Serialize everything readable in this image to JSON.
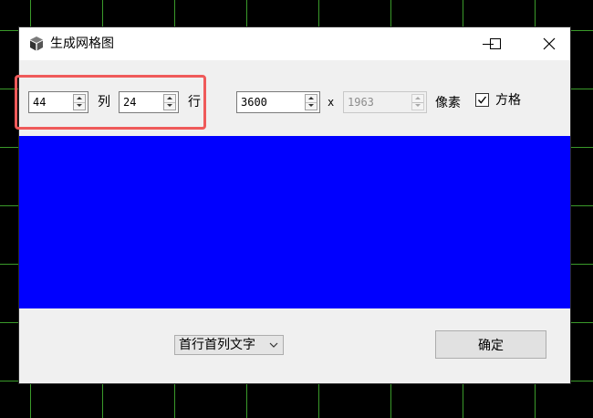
{
  "window": {
    "title": "生成网格图",
    "app_icon": "cube-icon",
    "controls": [
      "minimize-icon",
      "maximize-icon",
      "close-icon"
    ]
  },
  "grid": {
    "columns": {
      "value": "44",
      "label": "列"
    },
    "rows": {
      "value": "24",
      "label": "行"
    }
  },
  "size": {
    "width": "3600",
    "separator": "x",
    "height": "1963",
    "unit_label": "像素"
  },
  "square_option": {
    "label": "方格",
    "checked": true
  },
  "preview": {
    "color": "#0000ff"
  },
  "header_mode": {
    "selected": "首行首列文字"
  },
  "ok_button": {
    "label": "确定"
  },
  "colors": {
    "desktop_background": "#000000",
    "desktop_grid": "#3a9a2a",
    "highlight": "#ef5a5a",
    "dialog_background": "#f0f0f0"
  }
}
